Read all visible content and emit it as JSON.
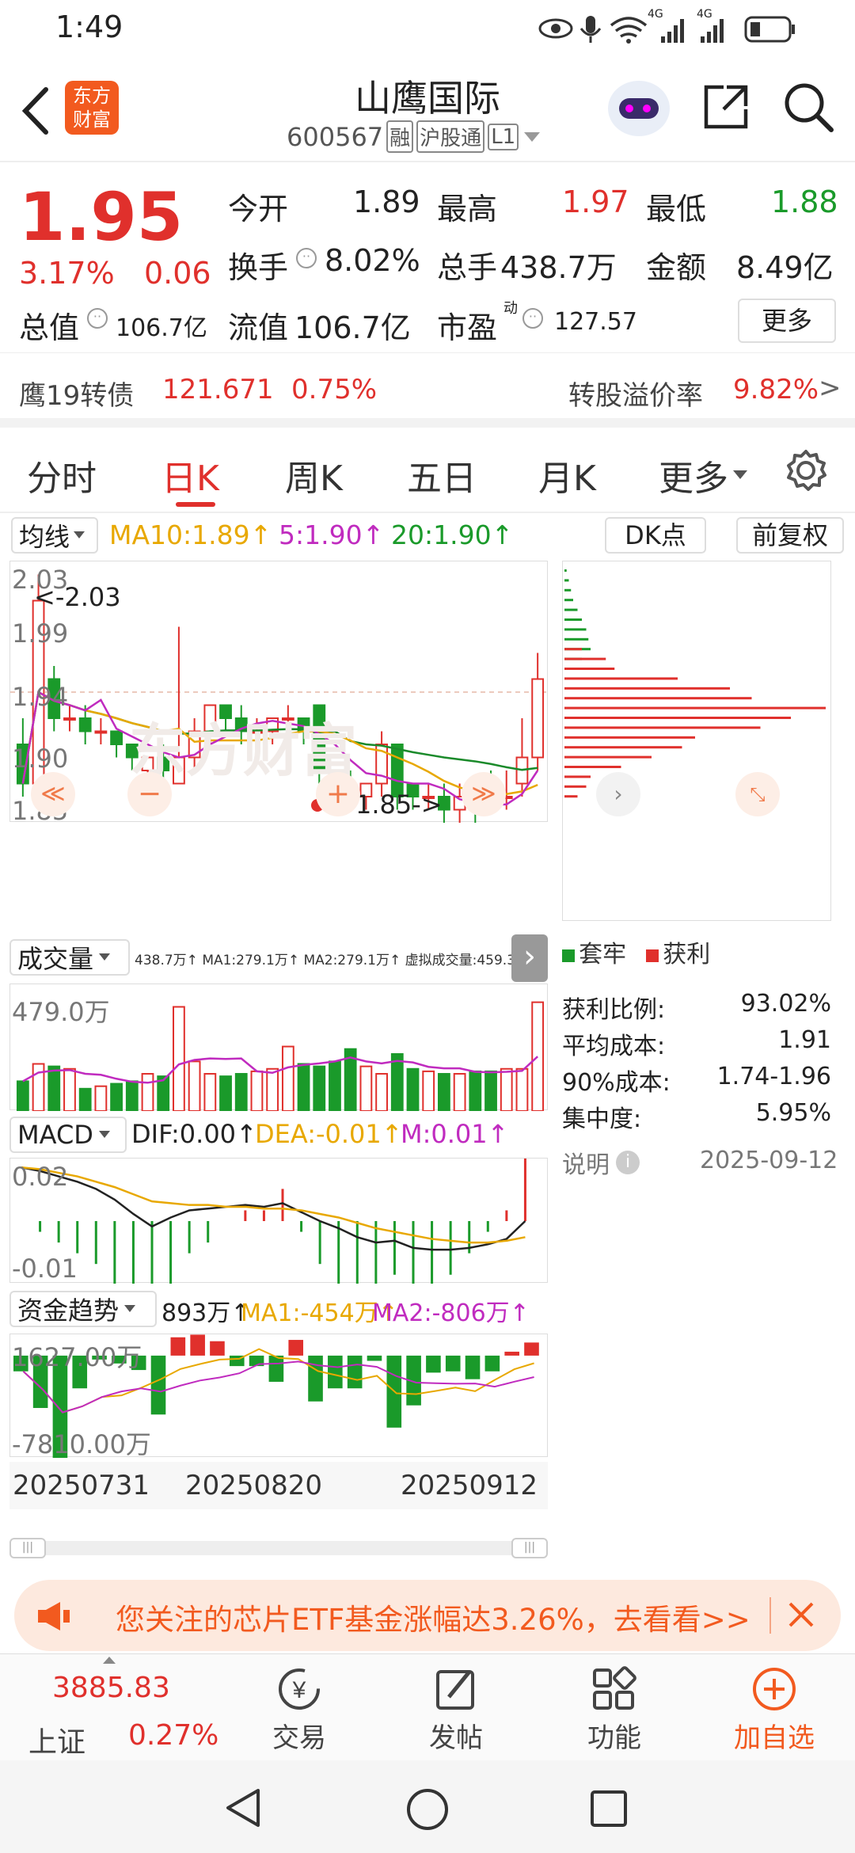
{
  "status": {
    "time": "1:49",
    "net1": "4G",
    "net2": "4G"
  },
  "header": {
    "title": "山鹰国际",
    "code": "600567",
    "tags": [
      "融",
      "沪股通",
      "L1"
    ]
  },
  "quote": {
    "price": "1.95",
    "pct": "3.17%",
    "chg": "0.06",
    "fields": [
      [
        "今开",
        "1.89"
      ],
      [
        "最高",
        "1.97"
      ],
      [
        "最低",
        "1.88"
      ],
      [
        "换手",
        "8.02%"
      ],
      [
        "总手",
        "438.7万"
      ],
      [
        "金额",
        "8.49亿"
      ],
      [
        "总值",
        "106.7亿"
      ],
      [
        "流值",
        "106.7亿"
      ],
      [
        "市盈",
        "127.57"
      ]
    ],
    "pe_sup": "动",
    "more": "更多"
  },
  "bond": {
    "name": "鹰19转债",
    "price": "121.671",
    "pct": "0.75%",
    "prem_label": "转股溢价率",
    "prem": "9.82%",
    "arrow": ">"
  },
  "tabs": [
    "分时",
    "日K",
    "周K",
    "五日",
    "月K",
    "更多"
  ],
  "chart": {
    "ma_btn": "均线",
    "ma10": "MA10:1.89↑",
    "ma5": "5:1.90↑",
    "ma20": "20:1.90↑",
    "dk": "DK点",
    "fq": "前复权",
    "y": [
      "2.03",
      "1.99",
      "1.94",
      "1.90",
      "1.85"
    ],
    "max_note": "<-2.03",
    "min_note": "1.85->",
    "watermark": "东方财富",
    "vol_btn": "成交量",
    "vol_info": "438.7万↑ MA1:279.1万↑ MA2:279.1万↑ 虚拟成交量:459.3万",
    "vol_y": "479.0万",
    "macd_btn": "MACD",
    "dif": "DIF:0.00↑",
    "dea": "DEA:-0.01↑",
    "m": "M:0.01↑",
    "macd_y": [
      "0.02",
      "-0.01"
    ],
    "flow_btn": "资金趋势",
    "flow_v": "893万↑",
    "flow_ma1": "MA1:-454万↑",
    "flow_ma2": "MA2:-806万↑",
    "flow_y": [
      "1627.00万",
      "-7810.00万"
    ],
    "dates": [
      "20250731",
      "20250820",
      "20250912"
    ]
  },
  "chips": {
    "legend": [
      "套牢",
      "获利"
    ],
    "rows": [
      [
        "获利比例:",
        "93.02%"
      ],
      [
        "平均成本:",
        "1.91"
      ],
      [
        "90%成本:",
        "1.74-1.96"
      ],
      [
        "集中度:",
        "5.95%"
      ]
    ],
    "note": "说明",
    "date": "2025-09-12"
  },
  "banner": {
    "text": "您关注的芯片ETF基金涨幅达3.26%，去看看>>"
  },
  "bottom": {
    "index_val": "3885.83",
    "index_name": "上证",
    "index_pct": "0.27%",
    "items": [
      "交易",
      "发帖",
      "功能",
      "加自选"
    ]
  },
  "colors": {
    "up": "#e0302c",
    "down": "#1a9a2a",
    "ma10": "#e8a800",
    "ma5": "#c02bbf",
    "ma20": "#1a8a2a"
  },
  "chart_data": {
    "type": "candlestick",
    "candles": [
      [
        1.9,
        1.87,
        1.92,
        1.86
      ],
      [
        1.87,
        2.01,
        2.03,
        1.87
      ],
      [
        1.95,
        1.92,
        1.96,
        1.91
      ],
      [
        1.92,
        1.92,
        1.93,
        1.91
      ],
      [
        1.92,
        1.91,
        1.93,
        1.9
      ],
      [
        1.91,
        1.91,
        1.92,
        1.9
      ],
      [
        1.91,
        1.9,
        1.91,
        1.89
      ],
      [
        1.9,
        1.89,
        1.9,
        1.88
      ],
      [
        1.88,
        1.89,
        1.89,
        1.87
      ],
      [
        1.89,
        1.88,
        1.9,
        1.87
      ],
      [
        1.87,
        1.89,
        1.99,
        1.87
      ],
      [
        1.89,
        1.91,
        1.92,
        1.88
      ],
      [
        1.91,
        1.93,
        1.93,
        1.9
      ],
      [
        1.93,
        1.92,
        1.93,
        1.91
      ],
      [
        1.92,
        1.91,
        1.93,
        1.9
      ],
      [
        1.91,
        1.91,
        1.92,
        1.9
      ],
      [
        1.91,
        1.92,
        1.92,
        1.9
      ],
      [
        1.92,
        1.92,
        1.93,
        1.91
      ],
      [
        1.92,
        1.91,
        1.92,
        1.9
      ],
      [
        1.93,
        1.88,
        1.93,
        1.87
      ],
      [
        1.88,
        1.87,
        1.88,
        1.86
      ],
      [
        1.87,
        1.86,
        1.88,
        1.85
      ],
      [
        1.86,
        1.87,
        1.87,
        1.85
      ],
      [
        1.87,
        1.9,
        1.91,
        1.86
      ],
      [
        1.9,
        1.86,
        1.9,
        1.85
      ],
      [
        1.87,
        1.86,
        1.87,
        1.85
      ],
      [
        1.86,
        1.86,
        1.87,
        1.85
      ],
      [
        1.86,
        1.85,
        1.87,
        1.84
      ],
      [
        1.85,
        1.86,
        1.87,
        1.84
      ],
      [
        1.86,
        1.85,
        1.87,
        1.84
      ],
      [
        1.87,
        1.85,
        1.88,
        1.85
      ],
      [
        1.86,
        1.86,
        1.88,
        1.85
      ],
      [
        1.87,
        1.89,
        1.92,
        1.86
      ],
      [
        1.89,
        1.95,
        1.97,
        1.88
      ]
    ],
    "volume_wan": [
      120,
      190,
      180,
      170,
      90,
      100,
      110,
      120,
      150,
      140,
      420,
      200,
      150,
      140,
      150,
      160,
      170,
      260,
      190,
      180,
      200,
      250,
      180,
      150,
      230,
      170,
      160,
      150,
      150,
      160,
      160,
      170,
      170,
      438.7
    ],
    "ma": {
      "MA10": 1.89,
      "MA5": 1.9,
      "MA20": 1.9
    },
    "dif": [
      0.03,
      0.028,
      0.025,
      0.022,
      0.018,
      0.012,
      0.004,
      -0.003,
      0.002,
      0.006,
      0.007,
      0.008,
      0.009,
      0.008,
      0.01,
      0.005,
      0.0,
      -0.004,
      -0.009,
      -0.012,
      -0.011,
      -0.015,
      -0.016,
      -0.016,
      -0.015,
      -0.013,
      -0.01,
      0.0
    ],
    "dea": [
      0.03,
      0.029,
      0.027,
      0.025,
      0.022,
      0.019,
      0.015,
      0.011,
      0.01,
      0.009,
      0.009,
      0.008,
      0.008,
      0.007,
      0.007,
      0.006,
      0.004,
      0.002,
      -0.001,
      -0.004,
      -0.006,
      -0.008,
      -0.01,
      -0.011,
      -0.012,
      -0.012,
      -0.011,
      -0.009
    ],
    "flow_wan": [
      -1200,
      -4000,
      -7810,
      -2500,
      -300,
      -600,
      -1100,
      -4500,
      1400,
      1600,
      1100,
      -800,
      -800,
      -2000,
      1200,
      -3500,
      -2500,
      -2500,
      -400,
      -5500,
      -3800,
      -1300,
      -1200,
      -1800,
      -1200,
      300,
      1000
    ],
    "chips_profit": [
      0,
      0,
      0,
      0,
      0,
      0,
      0,
      0,
      40,
      95,
      115,
      260,
      380,
      430,
      600,
      520,
      450,
      300,
      270,
      200,
      130,
      60,
      50,
      30
    ],
    "chips_trap": [
      5,
      10,
      15,
      20,
      30,
      40,
      50,
      55,
      60,
      40,
      0,
      0,
      0,
      0,
      0,
      0,
      0,
      0,
      0,
      0,
      0,
      0,
      0,
      0
    ]
  }
}
